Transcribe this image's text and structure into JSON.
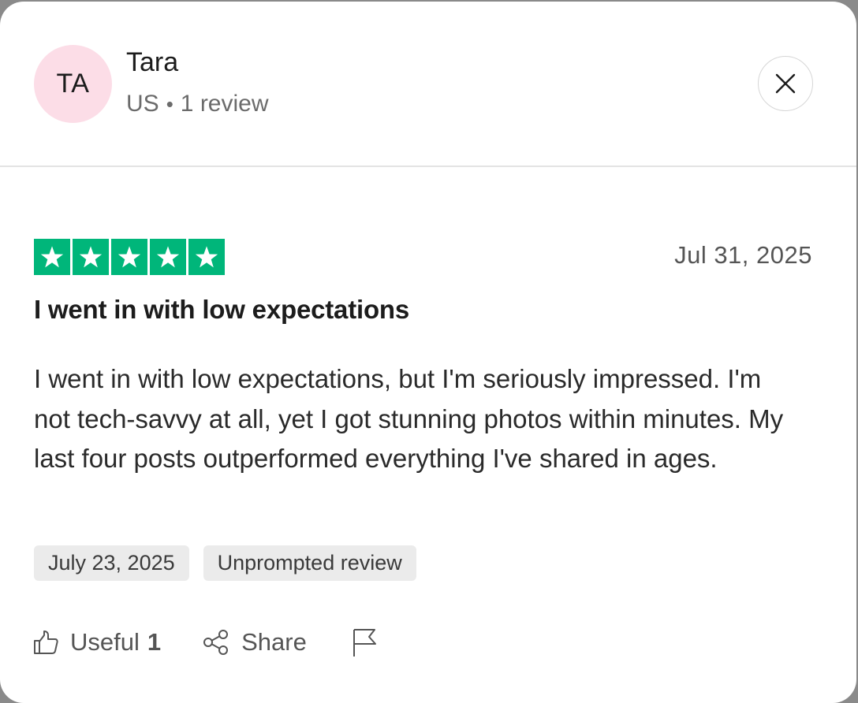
{
  "reviewer": {
    "initials": "TA",
    "name": "Tara",
    "country": "US",
    "separator": "•",
    "review_count": "1 review",
    "avatar_color": "#fcdde7"
  },
  "review": {
    "rating": 5,
    "max_rating": 5,
    "star_color": "#00b67a",
    "date": "Jul 31, 2025",
    "title": "I went in with low expectations",
    "body": "I went in with low expectations, but I'm seriously impressed. I'm not tech-savvy at all, yet I got stunning photos within minutes. My last four posts outperformed everything I've shared in ages.",
    "experience_date": "July 23, 2025",
    "label": "Unprompted review"
  },
  "actions": {
    "useful_label": "Useful",
    "useful_count": "1",
    "share_label": "Share",
    "useful_icon": "thumbs-up-icon",
    "share_icon": "share-icon",
    "flag_icon": "flag-icon"
  },
  "close_icon": "close-icon"
}
